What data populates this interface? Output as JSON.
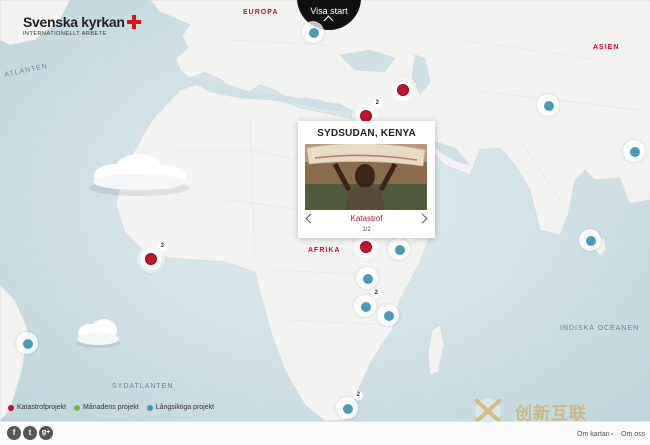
{
  "brand": {
    "name": "Svenska kyrkan",
    "subtitle": "INTERNATIONELLT ARBETE"
  },
  "start_button": {
    "label": "Visa start"
  },
  "regions": [
    {
      "label": "EUROPA",
      "kind": "land"
    },
    {
      "label": "ASIEN",
      "kind": "land"
    },
    {
      "label": "AFRIKA",
      "kind": "land"
    },
    {
      "label": "ATLANTEN",
      "kind": "sea"
    },
    {
      "label": "SYDATLANTEN",
      "kind": "sea"
    },
    {
      "label": "INDISKA OCEANEN",
      "kind": "sea"
    }
  ],
  "popup": {
    "title": "SYDSUDAN, KENYA",
    "category": "Katastrof",
    "pager": "1/2",
    "photo_icon": "person-carrying-sack-photo"
  },
  "markers": [
    {
      "type": "blue",
      "count": ""
    },
    {
      "type": "red",
      "count": ""
    },
    {
      "type": "red",
      "count": "2"
    },
    {
      "type": "blue",
      "count": ""
    },
    {
      "type": "blue",
      "count": ""
    },
    {
      "type": "blue",
      "count": ""
    },
    {
      "type": "red",
      "count": "3"
    },
    {
      "type": "red",
      "count": ""
    },
    {
      "type": "blue",
      "count": "2"
    },
    {
      "type": "blue",
      "count": ""
    },
    {
      "type": "blue",
      "count": "2"
    },
    {
      "type": "blue",
      "count": ""
    },
    {
      "type": "blue",
      "count": ""
    },
    {
      "type": "blue",
      "count": "2"
    }
  ],
  "legend": [
    {
      "label": "Katastrofprojekt",
      "color": "#c8102e"
    },
    {
      "label": "Månadens projekt",
      "color": "#6fbf3a"
    },
    {
      "label": "Långsiktiga projekt",
      "color": "#4a9bb8"
    }
  ],
  "footer": {
    "social": [
      {
        "icon": "facebook-icon",
        "glyph": "f"
      },
      {
        "icon": "twitter-icon",
        "glyph": "t"
      },
      {
        "icon": "googleplus-icon",
        "glyph": "g+"
      }
    ],
    "links": [
      "Om kartan",
      "Om oss"
    ]
  },
  "watermark": {
    "text": "创新互联"
  },
  "colors": {
    "sea": "#cfe0e4",
    "land": "#f2f2f0",
    "accent": "#c8102e"
  }
}
